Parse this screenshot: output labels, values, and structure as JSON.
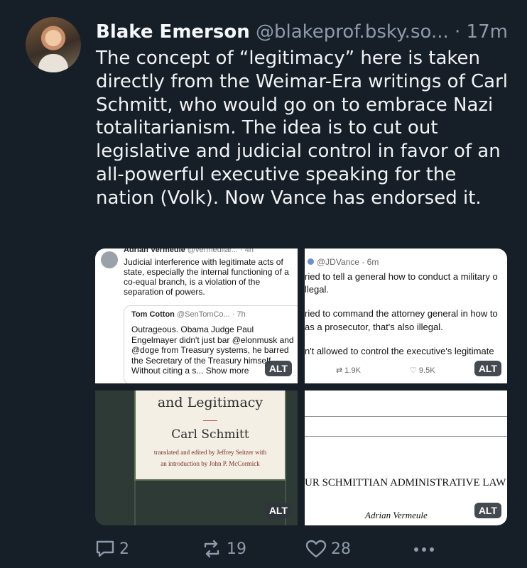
{
  "post": {
    "author_name": "Blake Emerson",
    "handle": "@blakeprof.bsky.so...",
    "separator": "·",
    "time": "17m",
    "text": "The concept of “legitimacy” here is taken directly from the Weimar-Era writings of Carl Schmitt, who would go on to embrace Nazi totalitarianism. The idea is to cut out legislative and judicial control in favor of an all-powerful executive speaking for the nation (Volk). Now Vance has endorsed it."
  },
  "images": {
    "alt_label": "ALT",
    "img1": {
      "author": "Adrian Vermeule",
      "handle": "@vermeullar... · 4h",
      "text": "Judicial interference with legitimate acts of state, especially the internal functioning of a co-equal branch, is a violation of the separation of powers.",
      "quote_author": "Tom Cotton",
      "quote_handle": "@SenTomCo... · 7h",
      "quote_text": "Outrageous. Obama Judge Paul Engelmayer didn't just bar @elonmusk and @doge from Treasury systems, he barred the Secretary of the Treasury himself. Without citing a s... Show more"
    },
    "img2": {
      "head": "@JDVance · 6m",
      "line1": "ried to tell a general how to conduct a military o",
      "line2": "llegal.",
      "line3": "ried to command the attorney general in how to",
      "line4": "as a prosecutor, that's also illegal.",
      "line5": "n't allowed to control the executive's legitimate",
      "reposts": "1.9K",
      "likes": "9.5K"
    },
    "img3": {
      "title": "and Legitimacy",
      "author": "Carl Schmitt",
      "credit1": "translated and edited by Jeffrey Seitzer with",
      "credit2": "an introduction by John P. McCormick"
    },
    "img4": {
      "heading": "UR SCHMITTIAN ADMINISTRATIVE LAW",
      "author": "Adrian Vermeule"
    }
  },
  "actions": {
    "replies": "2",
    "reposts": "19",
    "likes": "28"
  }
}
